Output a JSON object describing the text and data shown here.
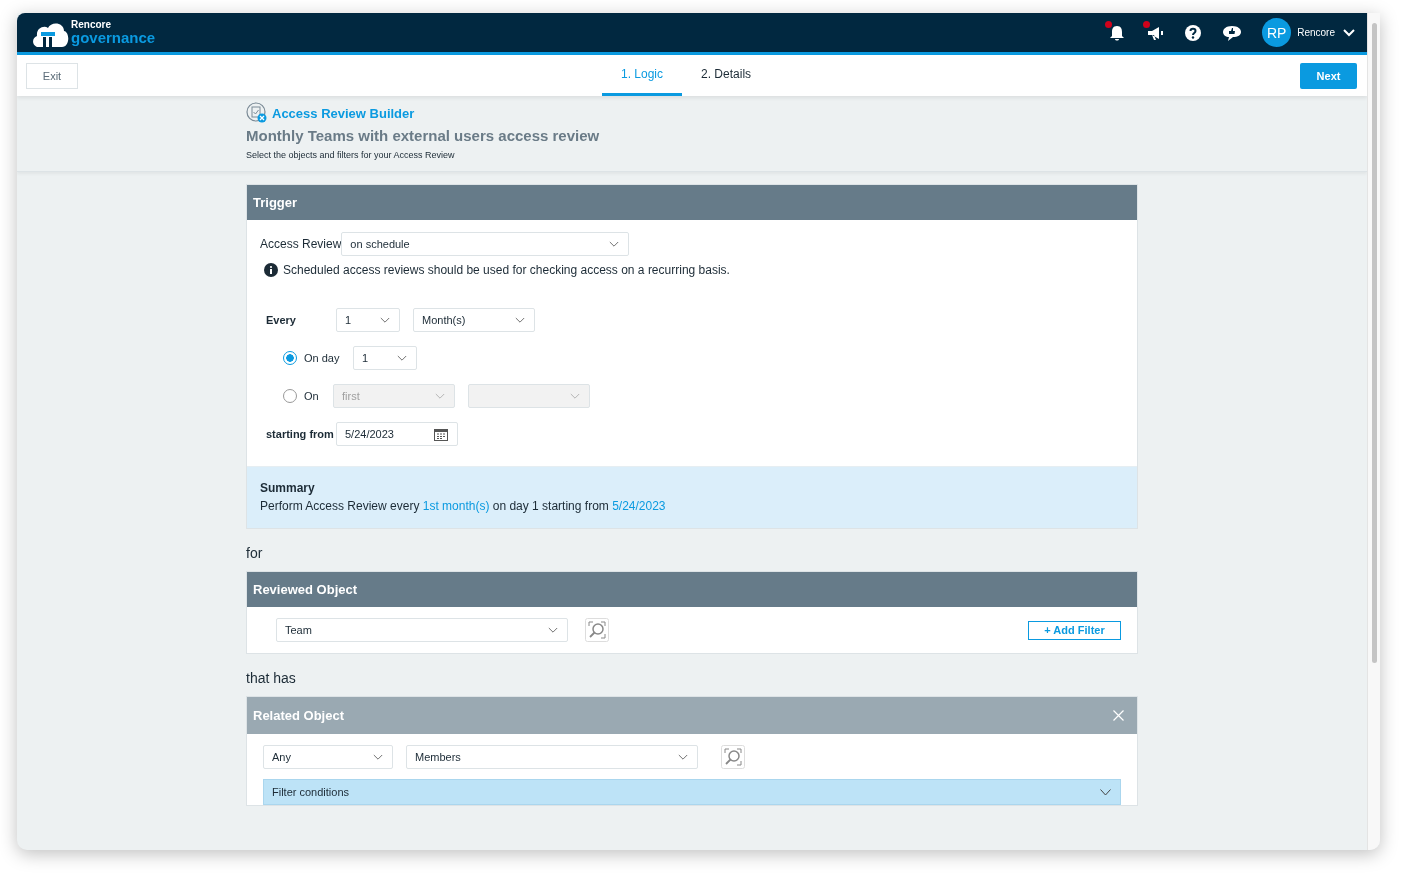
{
  "header": {
    "logo_top": "Rencore",
    "logo_bottom": "governance",
    "icons": [
      {
        "kind": "bell",
        "badge": true
      },
      {
        "kind": "megaphone",
        "badge": true
      },
      {
        "kind": "help",
        "badge": false
      },
      {
        "kind": "feedback",
        "badge": false
      }
    ],
    "avatar": "RP",
    "user": "Rencore"
  },
  "subnav": {
    "exit": "Exit",
    "tabs": [
      {
        "label": "1. Logic",
        "selected": true
      },
      {
        "label": "2. Details",
        "selected": false
      }
    ],
    "next": "Next"
  },
  "page": {
    "title": "Access Review Builder",
    "subtitle": "Monthly Teams with external users access review",
    "description": "Select the objects and filters for your Access Review"
  },
  "trigger": {
    "title": "Trigger",
    "access_review_label": "Access Review",
    "access_review_value": "on schedule",
    "info": "Scheduled access reviews should be used for checking access on a recurring basis.",
    "every_label": "Every",
    "every_value": "1",
    "unit_value": "Month(s)",
    "options": [
      {
        "kind": "on_day",
        "label": "On day",
        "selected": true,
        "selects": [
          {
            "value": "1",
            "disabled": false
          }
        ]
      },
      {
        "kind": "on",
        "label": "On",
        "selected": false,
        "selects": [
          {
            "value": "first",
            "disabled": true
          },
          {
            "disabled": true
          }
        ]
      }
    ],
    "starting_label": "starting from",
    "starting_value": "5/24/2023"
  },
  "summary": {
    "title": "Summary",
    "parts": [
      {
        "text": "Perform Access Review every ",
        "highlight": false
      },
      {
        "text": "1st month(s)",
        "highlight": true
      },
      {
        "text": " on day 1 starting from ",
        "highlight": false
      },
      {
        "text": "5/24/2023",
        "highlight": true
      }
    ]
  },
  "connector_1": "for",
  "reviewed": {
    "title": "Reviewed Object",
    "select": "Team",
    "add_filter": "+ Add Filter"
  },
  "connector_2": "that has",
  "related": {
    "title": "Related Object",
    "selects": [
      "Any",
      "Members"
    ],
    "filter_title": "Filter conditions"
  }
}
